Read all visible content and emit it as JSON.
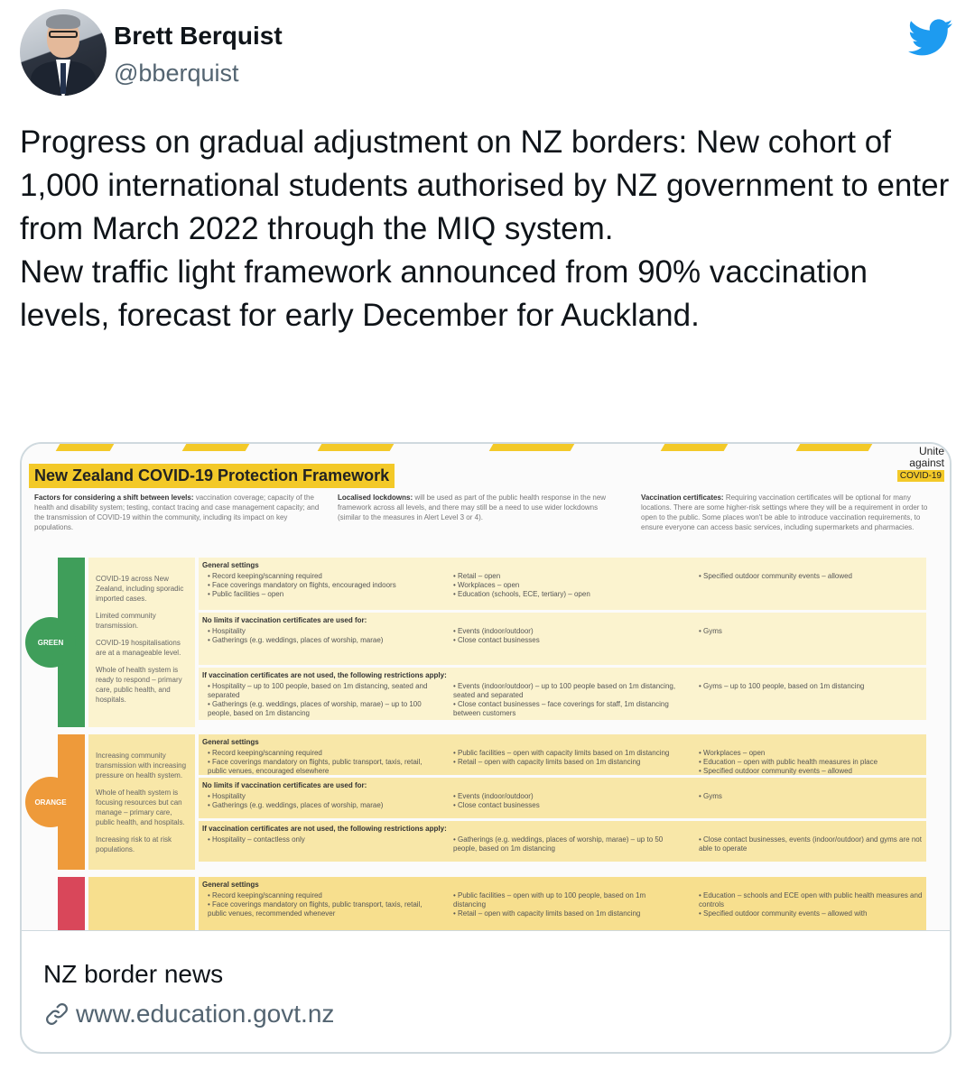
{
  "user": {
    "name": "Brett Berquist",
    "handle": "@bberquist"
  },
  "tweet": {
    "text": "Progress on gradual adjustment on NZ borders:  New cohort of 1,000 international students authorised by NZ government to enter from March 2022 through the MIQ system.\nNew traffic light framework announced from 90% vaccination levels, forecast for early December for Auckland."
  },
  "card": {
    "title": "NZ border news",
    "domain": "www.education.govt.nz",
    "image": {
      "title": "New Zealand COVID-19 Protection Framework",
      "logo": [
        "Unite",
        "against",
        "COVID-19"
      ],
      "intro": [
        {
          "head": "Factors for considering a shift between levels:",
          "body": "vaccination coverage; capacity of the health and disability system; testing, contact tracing and case management capacity; and the transmission of COVID-19 within the community, including its impact on key populations."
        },
        {
          "head": "Localised lockdowns:",
          "body": "will be used as part of the public health response in the new framework across all levels, and there may still be a need to use wider lockdowns (similar to the measures in Alert Level 3 or 4)."
        },
        {
          "head": "Vaccination certificates:",
          "body": "Requiring vaccination certificates will be optional for many locations. There are some higher-risk settings where they will be a requirement in order to open to the public. Some places won't be able to introduce vaccination requirements, to ensure everyone can access basic services, including supermarkets and pharmacies."
        }
      ],
      "levels": [
        {
          "label": "GREEN",
          "color": "#3f9e5a",
          "desc": [
            "COVID-19 across New Zealand, including sporadic imported cases.",
            "Limited community transmission.",
            "COVID-19 hospitalisations are at a manageable level.",
            "Whole of health system is ready to respond – primary care, public health, and hospitals."
          ],
          "sections": [
            {
              "head": "General settings",
              "cols": [
                [
                  "• Record keeping/scanning required",
                  "• Face coverings mandatory on flights, encouraged indoors",
                  "• Public facilities – open"
                ],
                [
                  "• Retail – open",
                  "• Workplaces – open",
                  "• Education (schools, ECE, tertiary) – open"
                ],
                [
                  "• Specified outdoor community events – allowed"
                ]
              ]
            },
            {
              "head": "No limits if vaccination certificates are used for:",
              "cols": [
                [
                  "• Hospitality",
                  "• Gatherings (e.g. weddings, places of worship, marae)"
                ],
                [
                  "• Events (indoor/outdoor)",
                  "• Close contact businesses"
                ],
                [
                  "• Gyms"
                ]
              ]
            },
            {
              "head": "If vaccination certificates are not used, the following restrictions apply:",
              "cols": [
                [
                  "• Hospitality – up to 100 people, based on 1m distancing, seated and separated",
                  "• Gatherings (e.g. weddings, places of worship, marae) – up to 100 people, based on 1m distancing"
                ],
                [
                  "• Events (indoor/outdoor) – up to 100 people based on 1m distancing, seated and separated",
                  "• Close contact businesses – face coverings for staff, 1m distancing between customers"
                ],
                [
                  "• Gyms – up to 100 people, based on 1m distancing"
                ]
              ]
            }
          ]
        },
        {
          "label": "ORANGE",
          "color": "#ee9a3a",
          "desc": [
            "Increasing community transmission with increasing pressure on health system.",
            "Whole of health system is focusing resources but can manage – primary care, public health, and hospitals.",
            "Increasing risk to at risk populations."
          ],
          "sections": [
            {
              "head": "General settings",
              "cols": [
                [
                  "• Record keeping/scanning required",
                  "• Face coverings mandatory on flights, public transport, taxis, retail, public venues, encouraged elsewhere"
                ],
                [
                  "• Public facilities – open with capacity limits based on 1m distancing",
                  "• Retail – open with capacity limits based on 1m distancing"
                ],
                [
                  "• Workplaces – open",
                  "• Education – open with public health measures in place",
                  "• Specified outdoor community events – allowed"
                ]
              ]
            },
            {
              "head": "No limits if vaccination certificates are used for:",
              "cols": [
                [
                  "• Hospitality",
                  "• Gatherings (e.g. weddings, places of worship, marae)"
                ],
                [
                  "• Events (indoor/outdoor)",
                  "• Close contact businesses"
                ],
                [
                  "• Gyms"
                ]
              ]
            },
            {
              "head": "If vaccination certificates are not used, the following restrictions apply:",
              "cols": [
                [
                  "• Hospitality – contactless only"
                ],
                [
                  "• Gatherings (e.g. weddings, places of worship, marae) – up to 50 people, based on 1m distancing"
                ],
                [
                  "• Close contact businesses, events (indoor/outdoor) and gyms are not able to operate"
                ]
              ]
            }
          ]
        },
        {
          "label": "",
          "color": "#d9475a",
          "desc": [],
          "sections": [
            {
              "head": "General settings",
              "cols": [
                [
                  "• Record keeping/scanning required",
                  "• Face coverings mandatory on flights, public transport, taxis, retail, public venues, recommended whenever"
                ],
                [
                  "• Public facilities – open with up to 100 people, based on 1m distancing",
                  "• Retail – open with capacity limits based on 1m distancing"
                ],
                [
                  "• Education – schools and ECE open with public health measures and controls",
                  "• Specified outdoor community events – allowed with"
                ]
              ]
            }
          ]
        }
      ]
    }
  }
}
